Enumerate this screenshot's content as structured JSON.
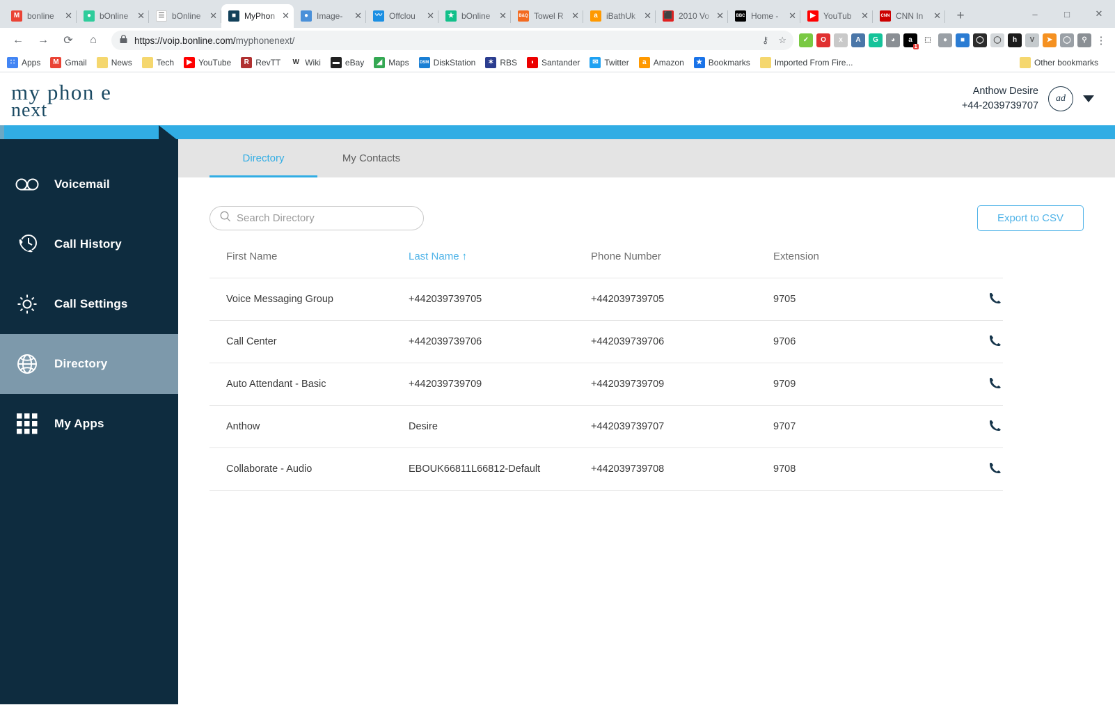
{
  "browser": {
    "tabs": [
      {
        "label": "bonline",
        "favicon": "gmail-icon",
        "color": "#ea4335",
        "glyph": "M"
      },
      {
        "label": "bOnline",
        "favicon": "leaf-icon",
        "color": "#2ecc9b",
        "glyph": "●"
      },
      {
        "label": "bOnline",
        "favicon": "document-icon",
        "color": "#ffffff",
        "glyph": "☰"
      },
      {
        "label": "MyPhon",
        "favicon": "myphone-icon",
        "color": "#12405a",
        "glyph": "■",
        "active": true
      },
      {
        "label": "Image-",
        "favicon": "globe-icon",
        "color": "#4a90d9",
        "glyph": "●"
      },
      {
        "label": "Offclou",
        "favicon": "offcloud-icon",
        "color": "#1a8fe3",
        "glyph": "〰"
      },
      {
        "label": "bOnline",
        "favicon": "star-icon",
        "color": "#12c08a",
        "glyph": "★"
      },
      {
        "label": "Towel R",
        "favicon": "bandq-icon",
        "color": "#f36b21",
        "glyph": "B&Q"
      },
      {
        "label": "iBathUk",
        "favicon": "amazon-icon",
        "color": "#ff9900",
        "glyph": "a"
      },
      {
        "label": "2010 Vo",
        "favicon": "pdf-icon",
        "color": "#e02020",
        "glyph": "⬛"
      },
      {
        "label": "Home -",
        "favicon": "bbc-icon",
        "color": "#000000",
        "glyph": "BBC"
      },
      {
        "label": "YouTub",
        "favicon": "youtube-icon",
        "color": "#ff0000",
        "glyph": "▶"
      },
      {
        "label": "CNN In",
        "favicon": "cnn-icon",
        "color": "#cc0000",
        "glyph": "CNN"
      }
    ],
    "tab_close_glyph": "✕",
    "new_tab_glyph": "+",
    "window_controls": {
      "minimize": "–",
      "maximize": "□",
      "close": "✕"
    },
    "nav": {
      "back": "←",
      "forward": "→",
      "reload": "⟳",
      "home": "⌂"
    },
    "omnibox": {
      "lock_icon": "🔒",
      "url_secure": "https://voip.bonline.com/",
      "url_path": "myphonenext/",
      "key_icon": "⚷",
      "star_icon": "☆"
    },
    "extensions": [
      {
        "name": "adblock-extension",
        "color": "#7ac943",
        "glyph": "✓"
      },
      {
        "name": "opera-extension",
        "color": "#e03131",
        "glyph": "O"
      },
      {
        "name": "x-extension",
        "color": "#c9c9c9",
        "glyph": "x"
      },
      {
        "name": "avast-extension",
        "color": "#4a76a8",
        "glyph": "A"
      },
      {
        "name": "grammarly-extension",
        "color": "#15c39a",
        "glyph": "G"
      },
      {
        "name": "ghostery-extension",
        "color": "#8a8f94",
        "glyph": "◕"
      },
      {
        "name": "amazon-assistant-extension",
        "color": "#000000",
        "glyph": "a",
        "badge": "1"
      },
      {
        "name": "screenshot-extension",
        "color": "#ffffff",
        "glyph": "⬚"
      },
      {
        "name": "pin-extension",
        "color": "#9aa0a6",
        "glyph": "●"
      },
      {
        "name": "blue-tile-extension",
        "color": "#2b7cd3",
        "glyph": "■"
      },
      {
        "name": "lastpass-extension",
        "color": "#2b2b2b",
        "glyph": "◯"
      },
      {
        "name": "circle-extension",
        "color": "#d4d8db",
        "glyph": "◯"
      },
      {
        "name": "honey-extension",
        "color": "#1a1a1a",
        "glyph": "h"
      },
      {
        "name": "v-extension",
        "color": "#c5cacd",
        "glyph": "V"
      },
      {
        "name": "orange-arrow-extension",
        "color": "#f59121",
        "glyph": "➤"
      },
      {
        "name": "oval-extension",
        "color": "#9aa0a6",
        "glyph": "◯"
      },
      {
        "name": "profile-avatar",
        "color": "#8a8f94",
        "glyph": "⚲"
      }
    ],
    "menu_glyph": "⋮",
    "bookmarks": [
      {
        "label": "Apps",
        "icon": "apps-grid-icon",
        "color": "#4285f4",
        "glyph": "∷"
      },
      {
        "label": "Gmail",
        "icon": "gmail-icon",
        "color": "#ea4335",
        "glyph": "M"
      },
      {
        "label": "News",
        "icon": "folder-icon",
        "color": "#f5d76e",
        "glyph": ""
      },
      {
        "label": "Tech",
        "icon": "folder-icon",
        "color": "#f5d76e",
        "glyph": ""
      },
      {
        "label": "YouTube",
        "icon": "youtube-icon",
        "color": "#ff0000",
        "glyph": "▶"
      },
      {
        "label": "RevTT",
        "icon": "revtt-icon",
        "color": "#b03030",
        "glyph": "R"
      },
      {
        "label": "Wiki",
        "icon": "wikipedia-icon",
        "color": "#ffffff",
        "glyph": "W"
      },
      {
        "label": "eBay",
        "icon": "ebay-icon",
        "color": "#222222",
        "glyph": "▬"
      },
      {
        "label": "Maps",
        "icon": "google-maps-icon",
        "color": "#34a853",
        "glyph": "◢"
      },
      {
        "label": "DiskStation",
        "icon": "synology-icon",
        "color": "#1a7fd4",
        "glyph": "DSM"
      },
      {
        "label": "RBS",
        "icon": "rbs-icon",
        "color": "#2b3d8f",
        "glyph": "✶"
      },
      {
        "label": "Santander",
        "icon": "santander-icon",
        "color": "#ec0000",
        "glyph": "◗"
      },
      {
        "label": "Twitter",
        "icon": "twitter-icon",
        "color": "#1da1f2",
        "glyph": "✉"
      },
      {
        "label": "Amazon",
        "icon": "amazon-icon",
        "color": "#ff9900",
        "glyph": "a"
      },
      {
        "label": "Bookmarks",
        "icon": "star-icon",
        "color": "#1a73e8",
        "glyph": "★"
      },
      {
        "label": "Imported From Fire...",
        "icon": "folder-icon",
        "color": "#f5d76e",
        "glyph": ""
      }
    ],
    "other_bookmarks": {
      "label": "Other bookmarks",
      "icon": "folder-icon",
      "color": "#f5d76e"
    }
  },
  "app": {
    "logo": {
      "line1": "my phon e",
      "line2": "next"
    },
    "user": {
      "name": "Anthow Desire",
      "phone": "+44-2039739707",
      "initials": "ad"
    },
    "accent_blue": "#31ade4",
    "sidebar_bg": "#0e2c3f",
    "sidebar_active_bg": "#7d99ab"
  },
  "sidebar": {
    "items": [
      {
        "label": "Voicemail",
        "icon": "voicemail-icon",
        "active": false
      },
      {
        "label": "Call History",
        "icon": "call-history-icon",
        "active": false
      },
      {
        "label": "Call Settings",
        "icon": "gear-icon",
        "active": false
      },
      {
        "label": "Directory",
        "icon": "globe-icon",
        "active": true
      },
      {
        "label": "My Apps",
        "icon": "apps-grid-icon",
        "active": false
      }
    ]
  },
  "main": {
    "tabs": [
      {
        "label": "Directory",
        "active": true
      },
      {
        "label": "My Contacts",
        "active": false
      }
    ],
    "search": {
      "value": "",
      "placeholder": "Search Directory",
      "icon": "search-icon"
    },
    "export_button": {
      "label": "Export to CSV"
    },
    "table": {
      "columns": [
        {
          "label": "First Name",
          "sorted": false
        },
        {
          "label": "Last Name",
          "sorted": true,
          "sort_arrow": "↑"
        },
        {
          "label": "Phone Number",
          "sorted": false
        },
        {
          "label": "Extension",
          "sorted": false
        },
        {
          "label": "",
          "sorted": false
        }
      ],
      "rows": [
        {
          "first_name": "Voice Messaging Group",
          "last_name": "+442039739705",
          "phone_number": "+442039739705",
          "extension": "9705",
          "call_icon": "phone-icon"
        },
        {
          "first_name": "Call Center",
          "last_name": "+442039739706",
          "phone_number": "+442039739706",
          "extension": "9706",
          "call_icon": "phone-icon"
        },
        {
          "first_name": "Auto Attendant - Basic",
          "last_name": "+442039739709",
          "phone_number": "+442039739709",
          "extension": "9709",
          "call_icon": "phone-icon"
        },
        {
          "first_name": "Anthow",
          "last_name": "Desire",
          "phone_number": "+442039739707",
          "extension": "9707",
          "call_icon": "phone-icon"
        },
        {
          "first_name": "Collaborate - Audio",
          "last_name": "EBOUK66811L66812-Default",
          "phone_number": "+442039739708",
          "extension": "9708",
          "call_icon": "phone-icon"
        }
      ]
    }
  }
}
